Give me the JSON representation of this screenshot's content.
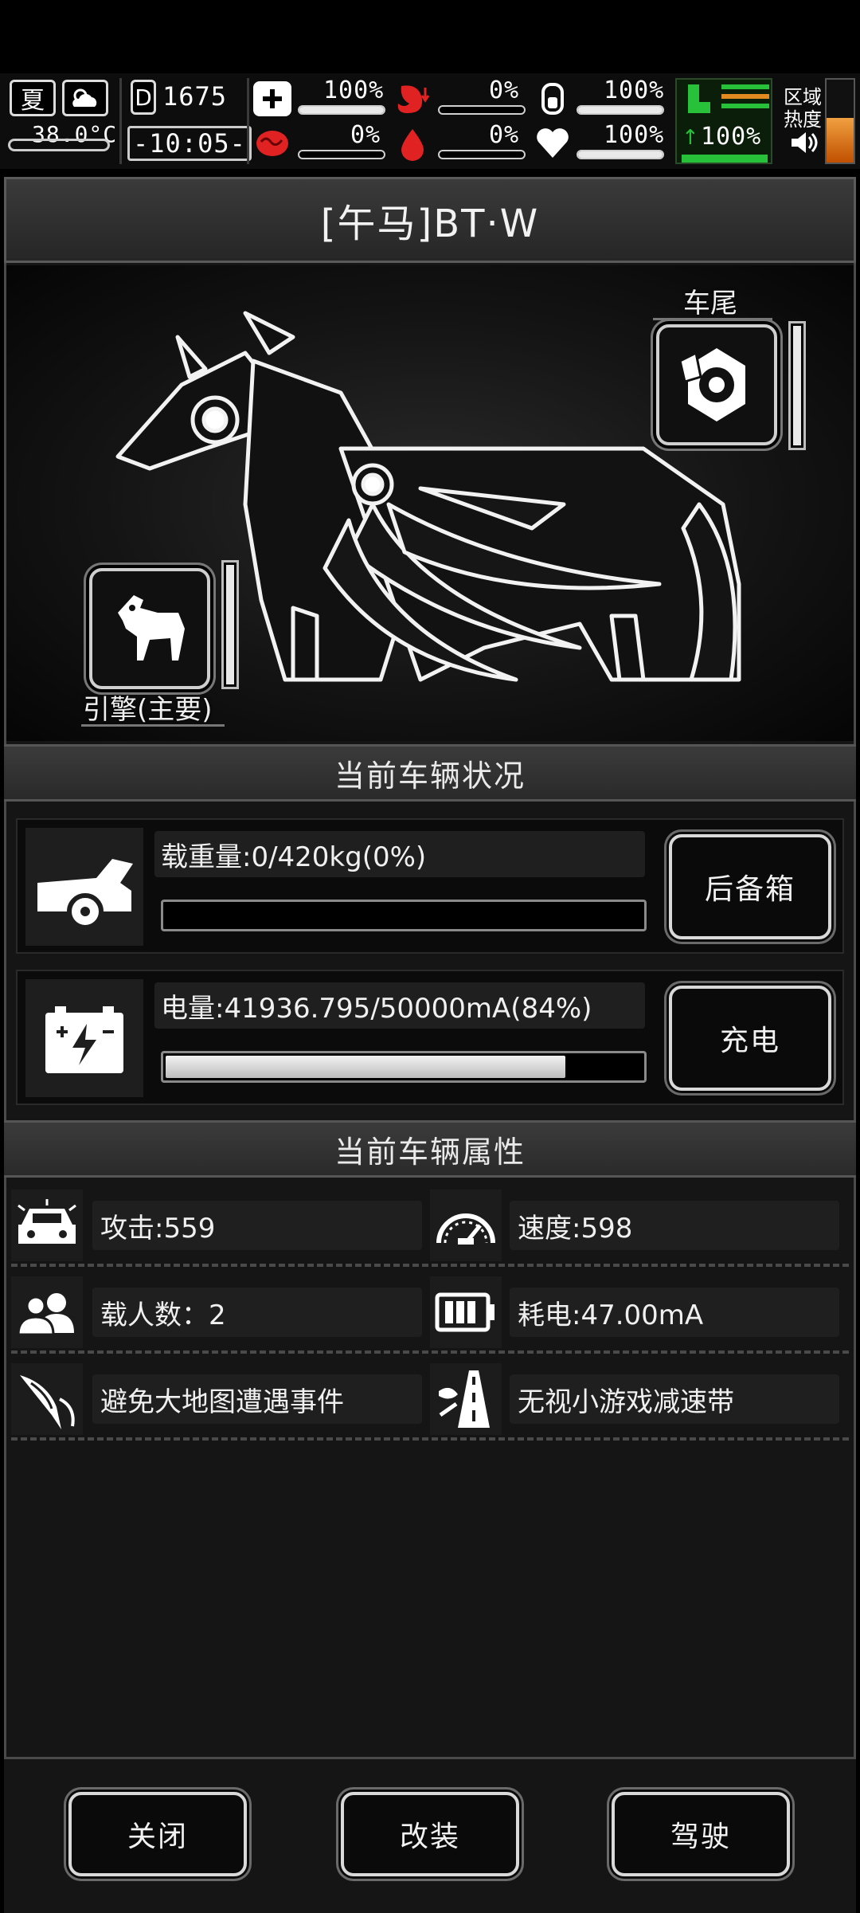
{
  "hud": {
    "season": "夏",
    "temperature": "38.0°C",
    "day_counter": "1675",
    "clock": "-10:05-",
    "stats": [
      {
        "name": "medkit",
        "value": "100%",
        "fill": 1.0
      },
      {
        "name": "stomach",
        "value": "0%",
        "fill": 0.0
      },
      {
        "name": "water",
        "value": "100%",
        "fill": 1.0
      },
      {
        "name": "brain",
        "value": "0%",
        "fill": 0.0
      },
      {
        "name": "blood",
        "value": "0%",
        "fill": 0.0
      },
      {
        "name": "heart",
        "value": "100%",
        "fill": 1.0
      },
      {
        "name": "stamina",
        "value": "100%",
        "fill": 1.0
      }
    ],
    "region_heat_label": "区域热度"
  },
  "vehicle": {
    "title": "[午马]BT·W",
    "slots": {
      "tail_label": "车尾",
      "engine_label": "引擎(主要)"
    }
  },
  "status_section": {
    "heading": "当前车辆状况",
    "load": {
      "label": "载重量:0/420kg(0%)",
      "fill": 0.0,
      "button": "后备箱"
    },
    "battery": {
      "label": "电量:41936.795/50000mA(84%)",
      "fill": 0.84,
      "button": "充电"
    }
  },
  "attr_section": {
    "heading": "当前车辆属性",
    "attrs": [
      {
        "label": "攻击:559",
        "icon": "car-attack-icon"
      },
      {
        "label": "速度:598",
        "icon": "speedometer-icon"
      },
      {
        "label": "载人数：2",
        "icon": "passengers-icon"
      },
      {
        "label": "耗电:47.00mA",
        "icon": "battery-icon"
      },
      {
        "label": "避免大地图遭遇事件",
        "icon": "wing-icon"
      },
      {
        "label": "无视小游戏减速带",
        "icon": "road-icon"
      }
    ]
  },
  "footer": {
    "close": "关闭",
    "modify": "改装",
    "drive": "驾驶"
  }
}
